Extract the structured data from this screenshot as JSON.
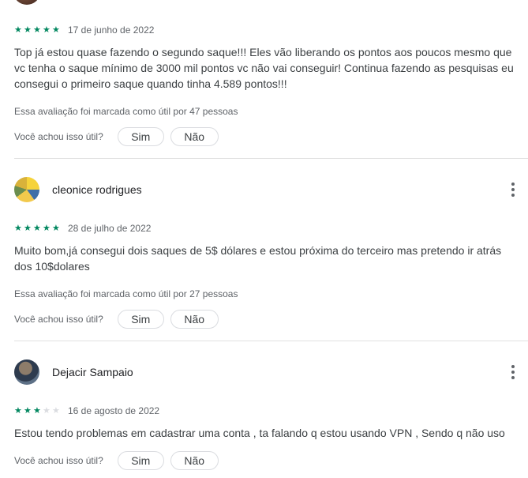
{
  "reviews": [
    {
      "author": "",
      "avatar": "user-avatar",
      "stars": 5,
      "date": "17 de junho de 2022",
      "text_lines": [
        "Top já estou quase fazendo o segundo saque!!! Eles vão liberando os pontos aos poucos mesmo que",
        "vc tenha o saque mínimo de 3000 mil pontos vc não vai conseguir! Continua fazendo as pesquisas eu",
        "consegui o primeiro saque quando tinha 4.589 pontos!!!"
      ],
      "helpful_count": "Essa avaliação foi marcada como útil por 47 pessoas"
    },
    {
      "author": "cleonice rodrigues",
      "avatar": "user-avatar",
      "stars": 5,
      "date": "28 de julho de 2022",
      "text_lines": [
        "Muito bom,já consegui dois saques de 5$ dólares e estou próxima do terceiro mas pretendo ir atrás",
        "dos 10$dolares"
      ],
      "helpful_count": "Essa avaliação foi marcada como útil por 27 pessoas"
    },
    {
      "author": "Dejacir Sampaio",
      "avatar": "user-avatar",
      "stars": 3,
      "date": "16 de agosto de 2022",
      "text_lines": [
        "Estou tendo problemas em cadastrar uma conta , ta falando q estou usando VPN , Sendo q não uso"
      ],
      "helpful_count": ""
    }
  ],
  "helpful": {
    "question": "Você achou isso útil?",
    "yes": "Sim",
    "no": "Não"
  },
  "icons": {
    "star": "star-icon",
    "more": "more-vert-icon"
  },
  "colors": {
    "star_on": "#01875f",
    "star_off": "#dadce0",
    "divider": "#e0e0e0"
  }
}
